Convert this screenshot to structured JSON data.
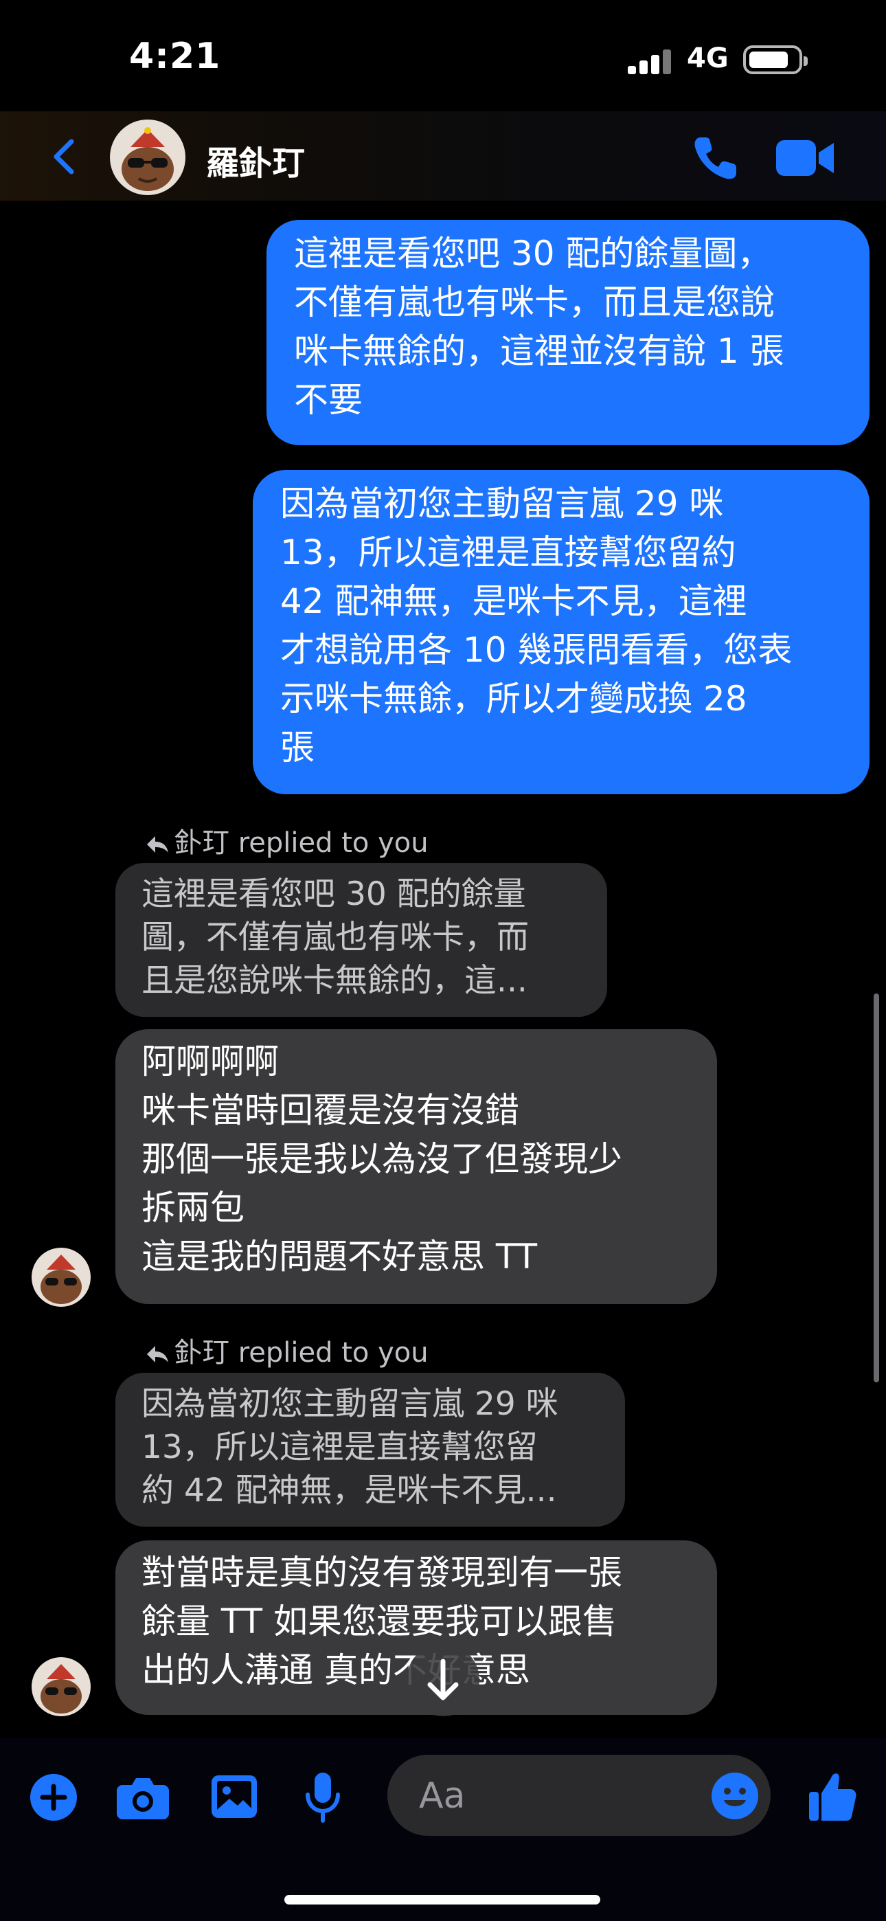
{
  "status_bar": {
    "time": "4:21",
    "network": "4G"
  },
  "header": {
    "contact_name": "羅釙玎"
  },
  "messages": {
    "out1": "這裡是看您吧 30 配的餘量圖，\n不僅有嵐也有咪卡，而且是您說\n咪卡無餘的，這裡並沒有說 1 張\n不要",
    "out2": "因為當初您主動留言嵐 29 咪\n13，所以這裡是直接幫您留約\n42 配神無，是咪卡不見，這裡\n才想說用各 10 幾張問看看，您表\n示咪卡無餘，所以才變成換 28\n張",
    "reply1_label": "釙玎 replied to you",
    "reply1_quote": "這裡是看您吧 30 配的餘量\n圖，不僅有嵐也有咪卡，而\n且是您說咪卡無餘的，這...",
    "in1": "阿啊啊啊\n咪卡當時回覆是沒有沒錯\n那個一張是我以為沒了但發現少\n拆兩包\n這是我的問題不好意思 TT",
    "reply2_label": "釙玎 replied to you",
    "reply2_quote": "因為當初您主動留言嵐 29 咪\n13，所以這裡是直接幫您留\n約 42 配神無，是咪卡不見...",
    "in2": "對當時是真的沒有發現到有一張\n餘量 TT 如果您還要我可以跟售\n出的人溝通 真的不好意思"
  },
  "composer": {
    "placeholder": "Aa"
  },
  "colors": {
    "accent": "#1d74ff",
    "incoming": "#3a3a3c",
    "quote": "#2b2b2d"
  },
  "icons": [
    "back-chevron-icon",
    "phone-icon",
    "video-camera-icon",
    "reply-arrow-icon",
    "plus-icon",
    "camera-icon",
    "gallery-icon",
    "microphone-icon",
    "emoji-icon",
    "thumbs-up-icon",
    "arrow-down-icon"
  ]
}
